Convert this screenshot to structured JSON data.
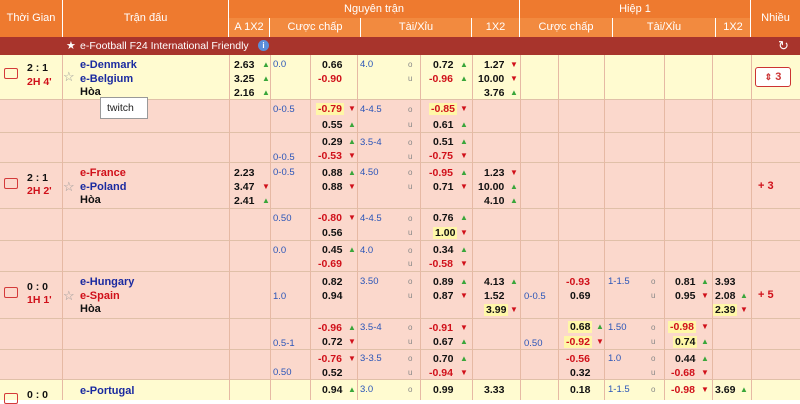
{
  "header": {
    "time": "Thời Gian",
    "match": "Trận đấu",
    "full": "Nguyên trận",
    "half": "Hiệp 1",
    "more": "Nhiều",
    "sub": [
      "A 1X2",
      "Cược chấp",
      "Tài/Xỉu",
      "1X2",
      "Cược chấp",
      "Tài/Xỉu",
      "1X2"
    ]
  },
  "league": "e-Football F24 International Friendly",
  "tooltip": "twitch",
  "m1": {
    "score": "2 : 1",
    "time": "2H 4'",
    "home": "e-Denmark",
    "away": "e-Belgium",
    "draw": "Hòa",
    "more": "3",
    "a1": "2.63",
    "a2": "3.25",
    "a3": "2.16",
    "hc": "0.0",
    "h1": "0.66",
    "h2": "-0.90",
    "ou": "4.0",
    "ou_u": "u",
    "o1": "0.72",
    "o2": "-0.96",
    "x1": "1.27",
    "x2": "10.00",
    "x3": "3.76",
    "r2": {
      "hc": "0-0.5",
      "h1": "-0.79",
      "h2": "0.55",
      "ou": "4-4.5",
      "o1": "-0.85",
      "o2": "0.61"
    },
    "r3": {
      "hc": "0-0.5",
      "h1": "0.29",
      "h2": "-0.53",
      "ou": "3.5-4",
      "o1": "0.51",
      "o2": "-0.75"
    }
  },
  "m2": {
    "score": "2 : 1",
    "time": "2H 2'",
    "home": "e-France",
    "away": "e-Poland",
    "draw": "Hòa",
    "more": "+ 3",
    "a1": "2.23",
    "a2": "3.47",
    "a3": "2.41",
    "hc": "0-0.5",
    "h1": "0.88",
    "h2": "0.88",
    "ou": "4.50",
    "o1": "-0.95",
    "o2": "0.71",
    "x1": "1.23",
    "x2": "10.00",
    "x3": "4.10",
    "r2": {
      "hc": "0.50",
      "h1": "-0.80",
      "h2": "0.56",
      "ou": "4-4.5",
      "o1": "0.76",
      "o2": "1.00"
    },
    "r3": {
      "hc": "0.0",
      "h1": "0.45",
      "h2": "-0.69",
      "ou": "4.0",
      "o1": "0.34",
      "o2": "-0.58"
    }
  },
  "m3": {
    "score": "0 : 0",
    "time": "1H 1'",
    "home": "e-Hungary",
    "away": "e-Spain",
    "draw": "Hòa",
    "more": "+ 5",
    "hc": "1.0",
    "h1": "0.82",
    "h2": "0.94",
    "ou": "3.50",
    "o1": "0.89",
    "o2": "0.87",
    "x1": "4.13",
    "x2": "1.52",
    "x3": "3.99",
    "hhc": "0-0.5",
    "hh1": "-0.93",
    "hh2": "0.69",
    "hou": "1-1.5",
    "ho1": "0.81",
    "ho2": "0.95",
    "hx1": "3.93",
    "hx2": "2.08",
    "hx3": "2.39",
    "r2": {
      "hc": "0.5-1",
      "h1": "-0.96",
      "h2": "0.72",
      "ou": "3.5-4",
      "o1": "-0.91",
      "o2": "0.67",
      "hhc": "0.50",
      "hh1": "0.68",
      "hh2": "-0.92",
      "hou": "1.50",
      "ho1": "-0.98",
      "ho2": "0.74"
    },
    "r3": {
      "hc": "0.50",
      "h1": "-0.76",
      "h2": "0.52",
      "ou": "3-3.5",
      "o1": "0.70",
      "o2": "-0.94",
      "hh1": "-0.56",
      "hh2": "0.32",
      "hou": "1.0",
      "ho1": "0.44",
      "ho2": "-0.68"
    }
  },
  "m4": {
    "score": "0 : 0",
    "home": "e-Portugal",
    "h1": "0.94",
    "ou": "3.0",
    "o1": "0.99",
    "x1": "3.33",
    "hh1": "0.18",
    "hou": "1-1.5",
    "ho1": "-0.98",
    "hx1": "3.69"
  }
}
